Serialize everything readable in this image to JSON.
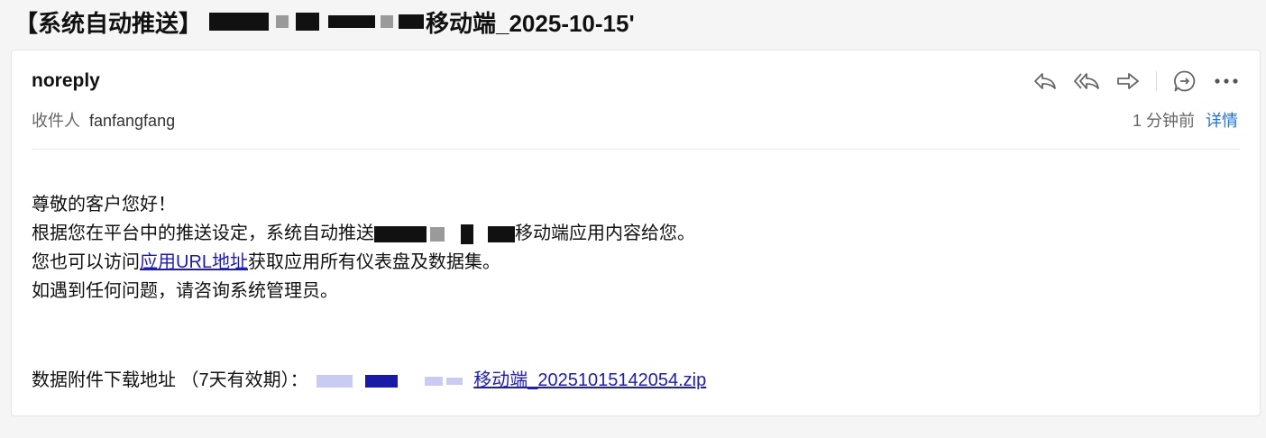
{
  "email": {
    "subject_prefix": "【系统自动推送】",
    "subject_suffix": "移动端_2025-10-15'",
    "sender": "noreply",
    "recipient_label": "收件人",
    "recipient_name": "fanfangfang",
    "time": "1 分钟前",
    "details_label": "详情",
    "greeting": "尊敬的客户您好！",
    "line2_prefix": "根据您在平台中的推送设定，系统自动推送",
    "line2_suffix": "移动端应用内容给您。",
    "line3_prefix": "您也可以访问",
    "line3_link": "应用URL地址",
    "line3_suffix": "获取应用所有仪表盘及数据集。",
    "line4": "如遇到任何问题，请咨询系统管理员。",
    "attachment_label": "数据附件下载地址 （7天有效期）：",
    "attachment_link": "移动端_20251015142054.zip"
  },
  "toolbar": {
    "icons": [
      "reply-icon",
      "reply-all-icon",
      "forward-icon",
      "chat-icon",
      "more-icon"
    ]
  },
  "colors": {
    "link": "#1a1acc",
    "details": "#1a73e8",
    "icon": "#666666"
  }
}
